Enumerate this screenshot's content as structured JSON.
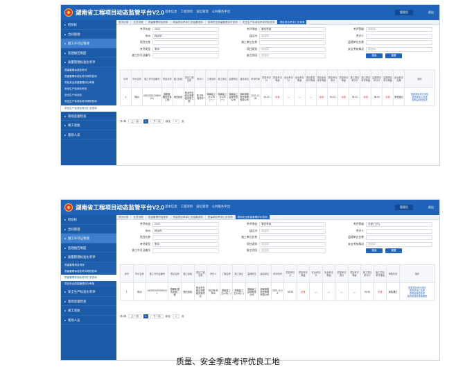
{
  "app_title": "湖南省工程项目动态监管平台V2.0",
  "top_nav": [
    "基本信息",
    "工程项目",
    "诚信管理",
    "公共服务平台"
  ],
  "admin_label": "管理员",
  "logout_label": "退出",
  "caption": "质量、安全季度考评优良工地",
  "shot1": {
    "sidebar": {
      "top_items": [
        {
          "label": "招投标"
        },
        {
          "label": "合同管理"
        },
        {
          "label": "施工许可证管理"
        },
        {
          "label": "监理报告制度"
        },
        {
          "label": "质量管理标准化考评"
        }
      ],
      "sub_items": [
        {
          "label": "质量管理标准化考评"
        },
        {
          "label": "质量管理标准化考评考核查询"
        },
        {
          "label": "项目安全质量管理评分考核"
        },
        {
          "label": "安全生产标准化考评"
        },
        {
          "label": "安全生产标准化"
        },
        {
          "label": "安全生产标准化考评考核查询"
        },
        {
          "label": "安全生产标准化考评汇总查询"
        }
      ],
      "bottom_items": [
        {
          "label": "现场监督检查"
        },
        {
          "label": "竣工验收"
        },
        {
          "label": "现场人员"
        }
      ]
    },
    "tabs": [
      "首页记录",
      "业务流程",
      "质量管理项目排序",
      "质量项目考评汇总结果查询",
      "现场安全质量管理评价查询",
      "安全生产标准化考评项目查询",
      "项目综合考评汇总查询"
    ],
    "form": {
      "row1": [
        {
          "label": "考评年度",
          "value": "2022"
        },
        {
          "label": "考评季度",
          "value": "第四季度"
        },
        {
          "label": "考评等级",
          "value": "请选择"
        }
      ],
      "row2": [
        {
          "label": "市州",
          "value": "株洲市"
        },
        {
          "label": "县区市",
          "value": "请选择"
        },
        {
          "label": "考评人",
          "value": ""
        }
      ],
      "row3": [
        {
          "label": "项目名称",
          "value": ""
        },
        {
          "label": "施工单位名称",
          "value": ""
        },
        {
          "label": "监理单位名称",
          "value": ""
        }
      ],
      "row4": [
        {
          "label": "考评类型",
          "value": "季评"
        },
        {
          "label": "项目类别",
          "value": "请选择"
        },
        {
          "label": "安全考核情况",
          "value": "请选择"
        }
      ],
      "row5": [
        {
          "label": "施工许可证编号",
          "value": ""
        },
        {
          "label": "施工阶段",
          "value": "请选择"
        }
      ],
      "search_label": "搜索",
      "reset_label": "重置"
    },
    "table": {
      "headers": [
        "序号",
        "市州名称",
        "施工许可证编号",
        "项目名称",
        "施工标段",
        "项目工程名称",
        "考评人",
        "工程名称",
        "施工单位",
        "监理单位",
        "建设单位",
        "考评时间",
        "质量考评分",
        "质量考评等级",
        "安全考评分",
        "安全考评等级",
        "项目质量考评等级",
        "项目安全考评等级",
        "质量考评得分",
        "质量考评等级",
        "施工项目考评分",
        "施工项目考评等级",
        "监理项目考评分",
        "监理项目考评等级",
        "安全考评结果",
        "操作"
      ],
      "rows": [
        [
          "1",
          "株洲",
          "43020020220800101",
          "德耀路·棚改安置工程",
          "第四标段",
          "株洲市石峰区德耀路安置工程",
          "陈卫锋,周伟华",
          "湖南建工五公司(一)",
          "湖南建工五公司(一)",
          "湖南建工监理有限公司",
          "湖南德耀投资管理有限公司",
          "2022-12-08",
          "94.22",
          "优良",
          "—",
          "—",
          "—",
          "优良",
          "94.22",
          "优良",
          "94.22",
          "优良",
          "88.90",
          "优良",
          "审核通过",
          "查看项目评分详情 / 查看考评汇总表 / 查看监督检查表"
        ]
      ]
    },
    "pager": {
      "total": "共1条",
      "prev": "上一页",
      "page": "1",
      "next": "下一页",
      "goto_label": "前往",
      "goto_value": "1",
      "page_suffix": "页"
    }
  },
  "shot2": {
    "sidebar": {
      "top_items": [
        {
          "label": "招投标"
        },
        {
          "label": "合同管理"
        },
        {
          "label": "施工许可证管理"
        },
        {
          "label": "监理报告制度"
        },
        {
          "label": "质量管理标准化考评"
        }
      ],
      "sub_items": [
        {
          "label": "质量管理项目排序"
        },
        {
          "label": "质量管理标准化考评考核查询"
        },
        {
          "label": "质量管理标准化考评汇总查询"
        },
        {
          "label": "项目安全质量管理评分考核"
        }
      ],
      "bottom_items": [
        {
          "label": "安全生产标准化考评"
        },
        {
          "label": "现场监督检查"
        },
        {
          "label": "竣工验收"
        },
        {
          "label": "现场人员"
        }
      ]
    },
    "tabs": [
      "首页记录",
      "业务流程",
      "质量管理项目排序",
      "质量项目考评汇总结果查询",
      "质量项目考评汇总查询",
      "现场安全质量管理评价查询"
    ],
    "form": {
      "row1": [
        {
          "label": "考评年度",
          "value": "2022"
        },
        {
          "label": "考评季度",
          "value": "第四季度"
        },
        {
          "label": "考评等级",
          "value": "全部(工作)"
        }
      ],
      "row2": [
        {
          "label": "市州",
          "value": "株洲市"
        },
        {
          "label": "县区市",
          "value": "请选择"
        },
        {
          "label": "考评人",
          "value": ""
        }
      ],
      "row3": [
        {
          "label": "项目名称",
          "value": ""
        },
        {
          "label": "施工单位名称",
          "value": ""
        },
        {
          "label": "监理单位名称",
          "value": ""
        }
      ],
      "row4": [
        {
          "label": "考评类型",
          "value": "季评"
        },
        {
          "label": "项目类别",
          "value": "请选择"
        },
        {
          "label": "安全考核情况",
          "value": "请选择"
        }
      ],
      "row5": [
        {
          "label": "施工许可证编号",
          "value": ""
        },
        {
          "label": "施工阶段",
          "value": "请选择"
        }
      ],
      "search_label": "搜索",
      "reset_label": "重置"
    },
    "table": {
      "headers": [
        "序号",
        "市州名称",
        "施工许可证编号",
        "项目名称",
        "施工标段",
        "项目工程名称",
        "考评人",
        "工程名称",
        "施工单位",
        "监理单位",
        "建设单位",
        "考评时间",
        "质量考评分",
        "质量考评等级",
        "安全考评分",
        "安全考评等级",
        "质量考评得分",
        "项目考评等级",
        "施工项目考评分",
        "施工项目考评等级",
        "审核状态",
        "操作"
      ],
      "rows": [
        [
          "1",
          "株洲",
          "43020020220800101",
          "德耀路·棚改安置工程",
          "第四标段",
          "株洲市石峰区德耀路安置项目",
          "陈卫锋,周伟华",
          "湖南建工五公司(一)",
          "湖南建工五公司(一)",
          "湖南建工监理有限公司",
          "湖南德耀投资管理有限公司",
          "2022-12-08",
          "94.95",
          "优良",
          "—",
          "—",
          "—",
          "—",
          "94.95",
          "优良",
          "审核通过",
          "查看项目评分详情 / 查看考评汇总表 / 查看监督检查表 / 查看现场质量管理表"
        ]
      ]
    },
    "pager": {
      "total": "共1条",
      "prev": "上一页",
      "page": "1",
      "next": "下一页",
      "goto_label": "前往",
      "goto_value": "1",
      "page_suffix": "页"
    }
  }
}
